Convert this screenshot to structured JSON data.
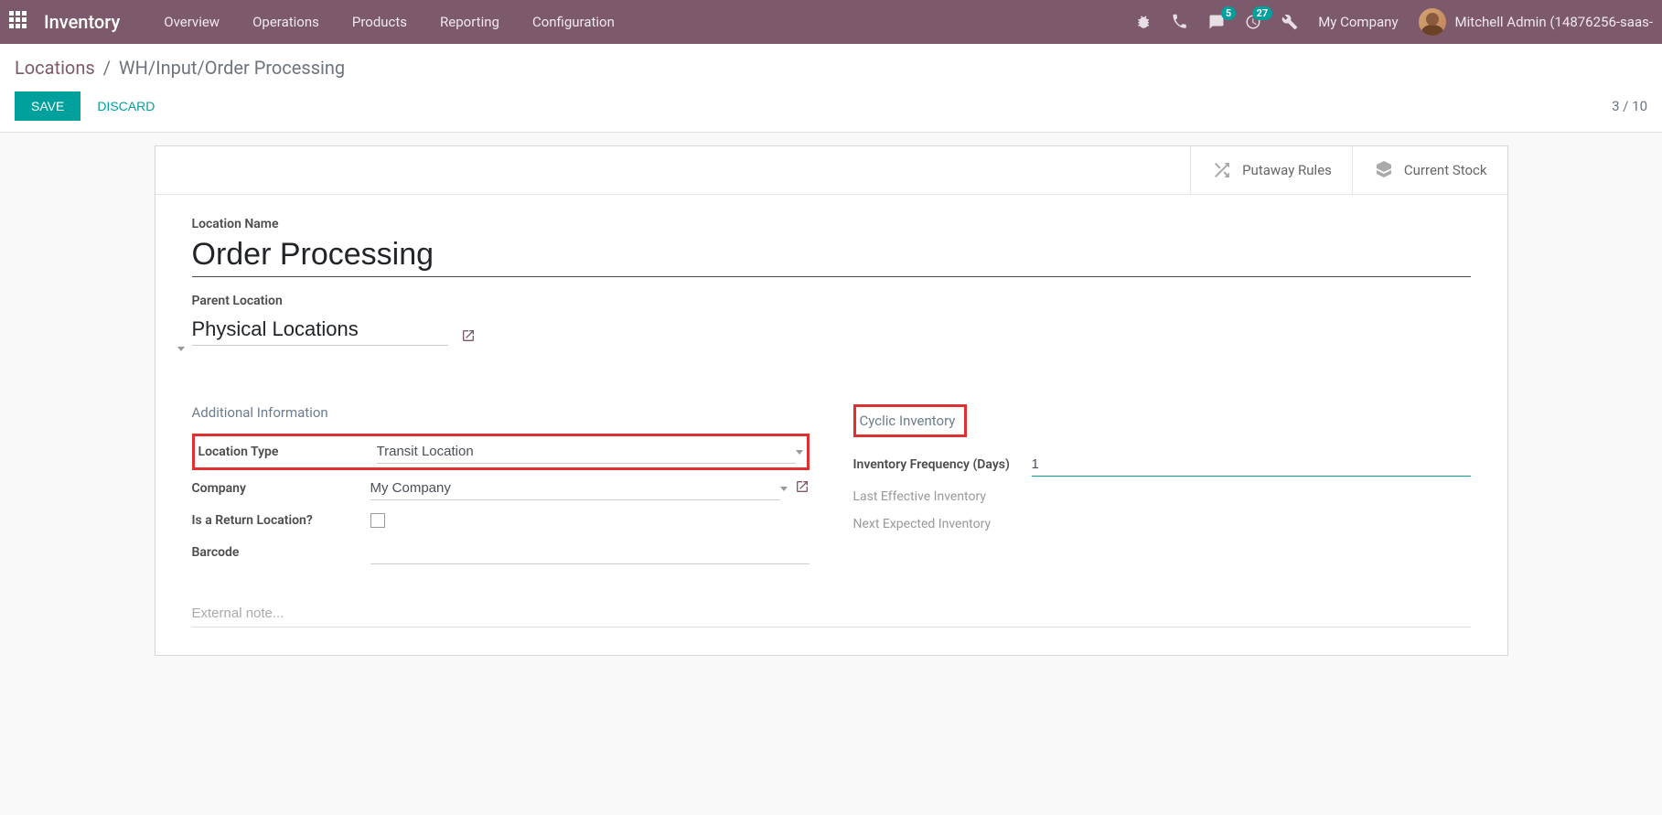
{
  "navbar": {
    "app_title": "Inventory",
    "menu": [
      "Overview",
      "Operations",
      "Products",
      "Reporting",
      "Configuration"
    ],
    "messages_badge": "5",
    "activities_badge": "27",
    "company": "My Company",
    "user": "Mitchell Admin (14876256-saas-"
  },
  "breadcrumb": {
    "root": "Locations",
    "current": "WH/Input/Order Processing"
  },
  "actions": {
    "save": "Save",
    "discard": "Discard",
    "pager": "3 / 10"
  },
  "stat_buttons": {
    "putaway": "Putaway Rules",
    "stock": "Current Stock"
  },
  "form": {
    "location_name_label": "Location Name",
    "location_name": "Order Processing",
    "parent_location_label": "Parent Location",
    "parent_location": "Physical Locations",
    "section_additional": "Additional Information",
    "section_cyclic": "Cyclic Inventory",
    "location_type_label": "Location Type",
    "location_type": "Transit Location",
    "company_label": "Company",
    "company": "My Company",
    "is_return_label": "Is a Return Location?",
    "barcode_label": "Barcode",
    "barcode": "",
    "inv_freq_label": "Inventory Frequency (Days)",
    "inv_freq": "1",
    "last_eff_label": "Last Effective Inventory",
    "next_exp_label": "Next Expected Inventory",
    "external_note_placeholder": "External note..."
  }
}
